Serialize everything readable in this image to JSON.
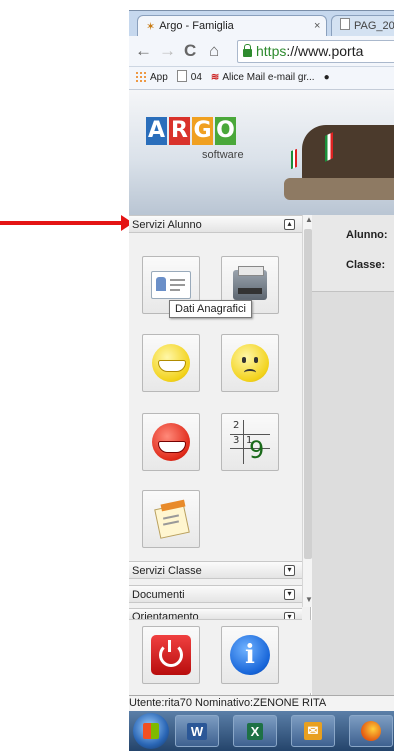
{
  "browser": {
    "active_tab_title": "Argo - Famiglia",
    "active_tab_close": "×",
    "second_tab_title": "PAG_20",
    "url_scheme": "https",
    "url_rest": "://www.porta",
    "nav_icons": [
      "back-arrow-icon",
      "forward-arrow-icon",
      "reload-icon",
      "home-icon"
    ]
  },
  "bookmarks": {
    "apps_label": "App",
    "item1_label": "04",
    "item2_label": "Alice Mail e-mail gr..."
  },
  "banner": {
    "logo_letters": [
      "A",
      "R",
      "G",
      "O"
    ],
    "logo_colors": [
      "#2a6ebb",
      "#d9322b",
      "#f0a020",
      "#4aa83a"
    ],
    "logo_subtitle": "software"
  },
  "sidebar": {
    "section_alunno": "Servizi Alunno",
    "section_classe": "Servizi Classe",
    "section_documenti": "Documenti",
    "section_orientamento": "Orientamento",
    "tooltip": "Dati Anagrafici",
    "grid_digits": [
      "2",
      "3",
      "1",
      "9"
    ],
    "tiles": [
      "id-card-icon",
      "printer-icon",
      "laughing-face-icon",
      "worried-face-icon",
      "devil-face-icon",
      "sudoku-grid-icon",
      "notes-icon"
    ],
    "bottom_buttons": [
      "power-icon",
      "info-icon"
    ]
  },
  "main": {
    "alunno_label": "Alunno:",
    "classe_label": "Classe:"
  },
  "status": {
    "user_text": "Utente:rita70 Nominativo:ZENONE RITA"
  },
  "taskbar": {
    "items": [
      "windows-start-icon",
      "word-icon",
      "excel-icon",
      "outlook-icon",
      "firefox-icon"
    ]
  },
  "colors": {
    "annotation_arrow": "#e41414"
  }
}
